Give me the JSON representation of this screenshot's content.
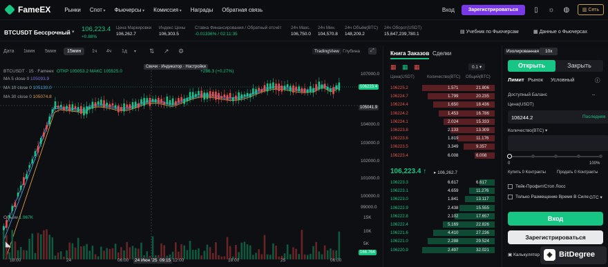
{
  "header": {
    "brand": "FameEX",
    "nav": [
      "Рынки",
      "Спот",
      "Фьючерсы",
      "Комиссия",
      "Награды",
      "Обратная связь"
    ],
    "login": "Вход",
    "register": "Зарегистрироваться",
    "network": "Сеть"
  },
  "ticker": {
    "symbol": "BTCUSDT Бессрочный",
    "price": "106,223.4",
    "change": "+0.88%",
    "stats": [
      {
        "label": "Цена Маркировки",
        "value": "106,262.7"
      },
      {
        "label": "Индекс Цены",
        "value": "106,303.5"
      },
      {
        "label": "Ставка Финансирования / Обратный отсчёт",
        "value": "-0.01336% / 02:11:35"
      },
      {
        "label": "24ч Макс.",
        "value": "106,750.0"
      },
      {
        "label": "24ч Мин.",
        "value": "104,570.8"
      },
      {
        "label": "24ч Объём(BTC)",
        "value": "148,209.2"
      },
      {
        "label": "24ч Оборот(USDT)",
        "value": "15,647,239,780.1"
      }
    ],
    "guide": "Учебник по Фьючерсам",
    "data_link": "Данные о Фьючерсах"
  },
  "chart": {
    "timeframes": [
      "Дата",
      "1мин",
      "5мин",
      "15мин",
      "1ч",
      "4ч",
      "1д"
    ],
    "active_tf": "15мин",
    "views": [
      "TradingView",
      "Глубина"
    ],
    "legend": "BTCUSDT · 15 · Fameex",
    "ohlc": "ОТКР 105053.2 МАКС 105525.0",
    "change_txt": "+286.3 (+0.27%)",
    "ma5": "MA 5 close 0",
    "ma5v": "105093.9",
    "ma10": "MA 10 close 0",
    "ma10v": "105130.0",
    "ma30": "MA 30 close 0",
    "ma30v": "105074.8",
    "tooltip": "Свечи · Индикатор · Настройки",
    "volume": "Объём",
    "volume_v": "1.967K",
    "price_axis": [
      "107000.0",
      "106223.4",
      "105041.9",
      "104000.0",
      "103000.0",
      "102000.0",
      "101000.0",
      "100000.0",
      "99000.0"
    ],
    "vol_axis": [
      "15K",
      "10K",
      "5K"
    ],
    "last_price_tag": "106223.4",
    "crosshair_tag": "105041.9",
    "vol_tag": "166.764",
    "time_axis": [
      "18:00",
      "24",
      "06:00",
      "24 Июн '25",
      "09:15",
      "12:00",
      "18:00",
      "25",
      "06:00"
    ]
  },
  "orderbook": {
    "tabs": [
      "Книга Заказов",
      "Сделки"
    ],
    "precision": "0.1",
    "cols": [
      "Цена(USDT)",
      "Количество(BTC)",
      "Общий(BTC)"
    ],
    "asks": [
      [
        "106225.2",
        "1.571",
        "21.806"
      ],
      [
        "106224.7",
        "1.799",
        "20.235"
      ],
      [
        "106224.4",
        "1.650",
        "18.436"
      ],
      [
        "106224.2",
        "1.453",
        "16.786"
      ],
      [
        "106224.1",
        "2.024",
        "15.333"
      ],
      [
        "106223.8",
        "2.133",
        "13.309"
      ],
      [
        "106223.6",
        "1.819",
        "11.176"
      ],
      [
        "106223.5",
        "3.349",
        "9.357"
      ],
      [
        "106223.4",
        "6.008",
        "6.008"
      ]
    ],
    "mid": "106,223.4",
    "mid_mark": "106,262.7",
    "bids": [
      [
        "106223.3",
        "6.617",
        "6.617"
      ],
      [
        "106223.1",
        "4.659",
        "11.276"
      ],
      [
        "106223.0",
        "1.841",
        "13.117"
      ],
      [
        "106222.9",
        "2.438",
        "15.555"
      ],
      [
        "106222.8",
        "2.102",
        "17.657"
      ],
      [
        "106222.4",
        "5.169",
        "22.826"
      ],
      [
        "106221.6",
        "4.410",
        "27.236"
      ],
      [
        "106221.0",
        "2.288",
        "29.524"
      ],
      [
        "106220.9",
        "2.497",
        "32.021"
      ]
    ]
  },
  "trade": {
    "leverage_tab": "Изолированная",
    "leverage": "10x",
    "open": "Открыть",
    "close": "Закрыть",
    "types": [
      "Лимит",
      "Рынок",
      "Условный"
    ],
    "balance": "Доступный Баланс",
    "balance_v": "--",
    "price_label": "Цена(USDT)",
    "price_val": "106244.2",
    "last": "Последняя",
    "qty_label": "Количество(BTC)",
    "slider_min": "0",
    "slider_max": "100%",
    "buy": "Купить 0 Контракты",
    "sell": "Продать 0 Контракты",
    "tpsl": "Тейк-Профит/Стоп Лосс",
    "post": "Только Размещение Время В Силе",
    "gtc": "GTC",
    "login_btn": "Вход",
    "reg_btn": "Зарегистрироваться",
    "calc": "Калькулятор",
    "watermark": "BitDegree"
  }
}
